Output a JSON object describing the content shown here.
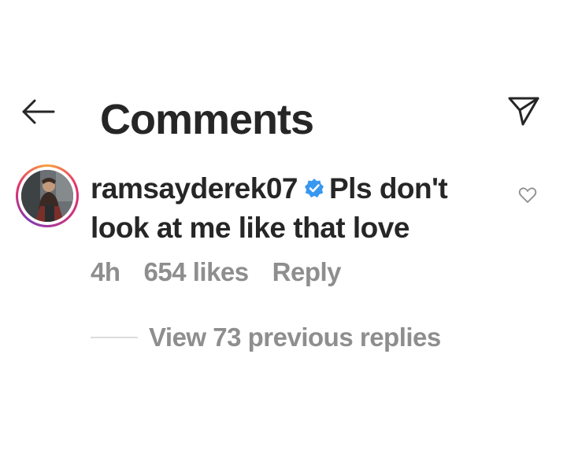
{
  "header": {
    "title": "Comments",
    "back_icon": "arrow-left-icon",
    "share_icon": "paper-plane-icon"
  },
  "comment": {
    "username": "ramsayderek07",
    "verified": true,
    "text": "Pls don't look at me like that love",
    "time": "4h",
    "likes": "654 likes",
    "reply_label": "Reply",
    "view_replies_label": "View 73 previous replies",
    "like_icon": "heart-outline-icon",
    "avatar_icon": "profile-photo"
  },
  "colors": {
    "text_primary": "#262626",
    "text_secondary": "#8e8e8e",
    "verified_blue": "#3897f0",
    "divider": "#dbdbdb",
    "story_ring": "#e1306c"
  }
}
